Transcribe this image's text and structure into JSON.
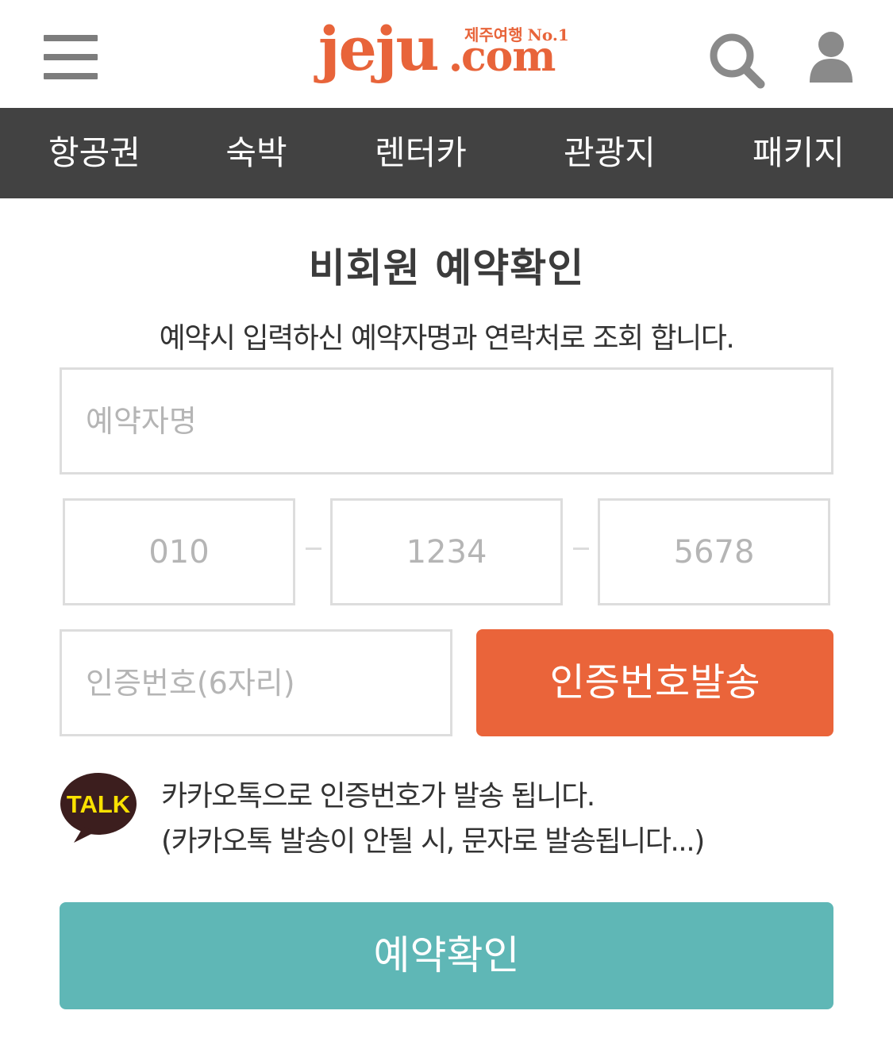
{
  "header": {
    "logo": {
      "main": "jeju",
      "com": "com",
      "tagline": "제주여행",
      "rank": "No.1"
    },
    "menu_icon": "hamburger-menu-icon",
    "search_icon": "search-icon",
    "user_icon": "user-icon"
  },
  "nav": {
    "items": [
      {
        "label": "항공권"
      },
      {
        "label": "숙박"
      },
      {
        "label": "렌터카"
      },
      {
        "label": "관광지"
      },
      {
        "label": "패키지"
      }
    ]
  },
  "form": {
    "title": "비회원 예약확인",
    "description": "예약시 입력하신 예약자명과 연락처로 조회 합니다.",
    "name_placeholder": "예약자명",
    "phone": {
      "part1_placeholder": "010",
      "part2_placeholder": "1234",
      "part3_placeholder": "5678"
    },
    "code_placeholder": "인증번호(6자리)",
    "send_code_button": "인증번호발송",
    "kakao_badge": "TALK",
    "kakao_line1": "카카오톡으로 인증번호가 발송 됩니다.",
    "kakao_line2": "(카카오톡 발송이 안될 시, 문자로 발송됩니다...)",
    "confirm_button": "예약확인"
  },
  "colors": {
    "brand_orange": "#ea643a",
    "nav_bg": "#424242",
    "confirm_teal": "#5fb7b6",
    "kakao_dark": "#3c1e1e",
    "kakao_yellow": "#fae100"
  }
}
